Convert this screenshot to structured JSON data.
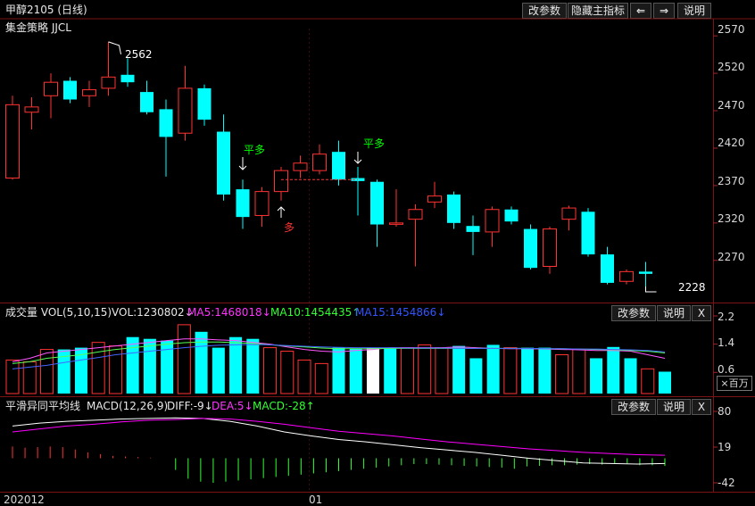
{
  "title": "甲醇2105 (日线)",
  "strategy": "集金策略 JJCL",
  "toolbar": {
    "params": "改参数",
    "hide_indicator": "隐藏主指标",
    "left_arrow": "⇐",
    "right_arrow": "⇒",
    "help": "说明"
  },
  "price_axis": [
    "2570",
    "2520",
    "2470",
    "2420",
    "2370",
    "2320",
    "2270"
  ],
  "annotations": {
    "high": "2562",
    "low": "2228",
    "flat_long_1": "平多",
    "flat_long_2": "平多",
    "long": "多"
  },
  "vol_panel": {
    "title": "成交量 VOL(5,10,15)",
    "vol": "VOL:1230802↓",
    "ma5": "MA5:1468018↓",
    "ma10": "MA10:1454435↑",
    "ma15": "MA15:1454866↓",
    "params": "改参数",
    "help": "说明",
    "close": "X",
    "axis": [
      "2.2",
      "1.4",
      "0.6"
    ],
    "unit": "×百万"
  },
  "macd_panel": {
    "title": "平滑异同平均线",
    "name": "MACD(12,26,9)",
    "diff": "DIFF:-9↓",
    "dea": "DEA:5↓",
    "macd": "MACD:-28↑",
    "params": "改参数",
    "help": "说明",
    "close": "X",
    "axis": [
      "80",
      "19",
      "-42"
    ]
  },
  "date_axis": [
    "202012",
    "01"
  ],
  "colors": {
    "up": "#ff3232",
    "down": "#00ffff",
    "ma5": "#ffffff",
    "ma10": "#ffff00",
    "ma15": "#ff00ff",
    "diff": "#ffffff",
    "dea": "#ff00ff"
  },
  "chart_data": [
    {
      "type": "candlestick",
      "title": "甲醇2105 (日线)",
      "ylim": [
        2228,
        2575
      ],
      "candles": [
        {
          "o": 2380,
          "h": 2490,
          "l": 2378,
          "c": 2478
        },
        {
          "o": 2468,
          "h": 2488,
          "l": 2445,
          "c": 2475
        },
        {
          "o": 2490,
          "h": 2520,
          "l": 2460,
          "c": 2508
        },
        {
          "o": 2510,
          "h": 2515,
          "l": 2480,
          "c": 2485
        },
        {
          "o": 2490,
          "h": 2510,
          "l": 2475,
          "c": 2498
        },
        {
          "o": 2500,
          "h": 2562,
          "l": 2490,
          "c": 2515
        },
        {
          "o": 2518,
          "h": 2540,
          "l": 2502,
          "c": 2508
        },
        {
          "o": 2495,
          "h": 2510,
          "l": 2465,
          "c": 2468
        },
        {
          "o": 2472,
          "h": 2485,
          "l": 2382,
          "c": 2435
        },
        {
          "o": 2440,
          "h": 2530,
          "l": 2430,
          "c": 2500
        },
        {
          "o": 2500,
          "h": 2505,
          "l": 2450,
          "c": 2458
        },
        {
          "o": 2442,
          "h": 2465,
          "l": 2350,
          "c": 2358
        },
        {
          "o": 2365,
          "h": 2378,
          "l": 2312,
          "c": 2328
        },
        {
          "o": 2330,
          "h": 2368,
          "l": 2315,
          "c": 2362
        },
        {
          "o": 2362,
          "h": 2395,
          "l": 2350,
          "c": 2390
        },
        {
          "o": 2390,
          "h": 2410,
          "l": 2380,
          "c": 2400
        },
        {
          "o": 2390,
          "h": 2425,
          "l": 2385,
          "c": 2412
        },
        {
          "o": 2415,
          "h": 2430,
          "l": 2370,
          "c": 2378
        },
        {
          "o": 2380,
          "h": 2395,
          "l": 2330,
          "c": 2376
        },
        {
          "o": 2375,
          "h": 2378,
          "l": 2288,
          "c": 2318
        },
        {
          "o": 2320,
          "h": 2365,
          "l": 2315,
          "c": 2320
        },
        {
          "o": 2325,
          "h": 2345,
          "l": 2262,
          "c": 2338
        },
        {
          "o": 2348,
          "h": 2375,
          "l": 2340,
          "c": 2356
        },
        {
          "o": 2358,
          "h": 2362,
          "l": 2312,
          "c": 2320
        },
        {
          "o": 2316,
          "h": 2330,
          "l": 2277,
          "c": 2308
        },
        {
          "o": 2308,
          "h": 2342,
          "l": 2288,
          "c": 2338
        },
        {
          "o": 2338,
          "h": 2342,
          "l": 2318,
          "c": 2322
        },
        {
          "o": 2312,
          "h": 2318,
          "l": 2258,
          "c": 2260
        },
        {
          "o": 2262,
          "h": 2315,
          "l": 2252,
          "c": 2312
        },
        {
          "o": 2325,
          "h": 2343,
          "l": 2310,
          "c": 2340
        },
        {
          "o": 2335,
          "h": 2340,
          "l": 2275,
          "c": 2278
        },
        {
          "o": 2278,
          "h": 2288,
          "l": 2238,
          "c": 2240
        },
        {
          "o": 2242,
          "h": 2258,
          "l": 2238,
          "c": 2255
        },
        {
          "o": 2255,
          "h": 2268,
          "l": 2228,
          "c": 2252
        }
      ]
    },
    {
      "type": "bar",
      "title": "成交量 VOL(5,10,15)",
      "ylabel": "×百万",
      "ylim": [
        0,
        2.2
      ],
      "values": [
        0.95,
        0.9,
        1.25,
        1.25,
        1.3,
        1.45,
        1.35,
        1.6,
        1.55,
        1.5,
        1.95,
        1.75,
        1.3,
        1.6,
        1.55,
        1.3,
        1.2,
        0.95,
        0.85,
        1.3,
        1.28,
        1.3,
        1.3,
        1.3,
        1.38,
        1.3,
        1.35,
        1.0,
        1.38,
        1.3,
        1.3,
        1.3,
        1.1,
        1.25,
        1.0,
        1.32,
        1.0,
        0.7,
        0.62
      ],
      "series": [
        {
          "name": "MA5",
          "values": [
            0.9,
            1.0,
            1.15,
            1.2,
            1.25,
            1.3,
            1.35,
            1.4,
            1.45,
            1.5,
            1.55,
            1.55,
            1.52,
            1.5,
            1.45,
            1.4,
            1.32,
            1.25,
            1.2,
            1.18,
            1.22,
            1.25,
            1.3,
            1.3,
            1.3,
            1.3,
            1.32,
            1.3,
            1.28,
            1.27,
            1.27,
            1.26,
            1.25,
            1.24,
            1.22,
            1.22,
            1.2,
            1.1,
            1.0
          ]
        },
        {
          "name": "MA10",
          "values": [
            0.85,
            0.9,
            1.0,
            1.05,
            1.1,
            1.18,
            1.25,
            1.3,
            1.35,
            1.4,
            1.44,
            1.46,
            1.46,
            1.44,
            1.42,
            1.38,
            1.35,
            1.32,
            1.29,
            1.27,
            1.27,
            1.27,
            1.28,
            1.28,
            1.28,
            1.28,
            1.28,
            1.28,
            1.28,
            1.28,
            1.28,
            1.27,
            1.27,
            1.26,
            1.25,
            1.24,
            1.22,
            1.2,
            1.15
          ]
        },
        {
          "name": "MA15",
          "values": [
            0.7,
            0.75,
            0.8,
            0.88,
            0.95,
            1.02,
            1.1,
            1.15,
            1.2,
            1.25,
            1.3,
            1.34,
            1.37,
            1.38,
            1.39,
            1.38,
            1.36,
            1.34,
            1.32,
            1.31,
            1.3,
            1.3,
            1.3,
            1.29,
            1.29,
            1.29,
            1.28,
            1.28,
            1.28,
            1.28,
            1.28,
            1.27,
            1.27,
            1.26,
            1.26,
            1.25,
            1.24,
            1.22,
            1.18
          ]
        }
      ]
    },
    {
      "type": "bar",
      "title": "MACD(12,26,9)",
      "ylim": [
        -42,
        80
      ],
      "values": [
        20,
        18,
        19,
        20,
        19,
        15,
        10,
        7,
        4,
        3,
        2,
        1,
        0,
        -20,
        -35,
        -40,
        -42,
        -40,
        -38,
        -36,
        -34,
        -32,
        -30,
        -28,
        -26,
        -24,
        -22,
        -20,
        -18,
        -16,
        -14,
        -12,
        -10,
        -10,
        -11,
        -12,
        -13,
        -14,
        -15,
        -16,
        -18,
        -14,
        -13,
        -12,
        -12,
        -11,
        -10,
        -11,
        -10,
        -9,
        -12,
        -12,
        -13
      ],
      "series": [
        {
          "name": "DIFF",
          "values": [
            55,
            60,
            63,
            65,
            67,
            68,
            69,
            68,
            63,
            55,
            45,
            38,
            32,
            28,
            23,
            18,
            14,
            10,
            5,
            0,
            -4,
            -8,
            -9,
            -10,
            -9
          ]
        },
        {
          "name": "DEA",
          "values": [
            45,
            50,
            55,
            58,
            62,
            65,
            66,
            68,
            67,
            63,
            58,
            52,
            46,
            42,
            38,
            33,
            28,
            24,
            20,
            16,
            13,
            10,
            8,
            6,
            5
          ]
        }
      ]
    }
  ]
}
